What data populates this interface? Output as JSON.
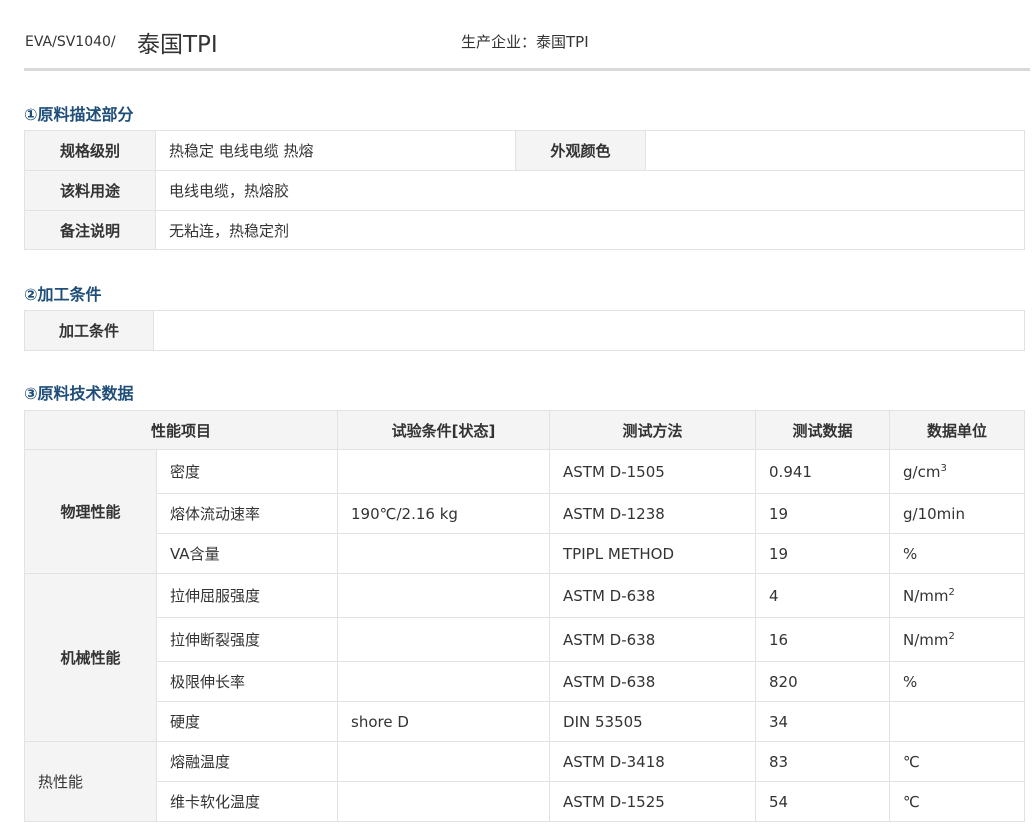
{
  "header": {
    "code": "EVA/SV1040/",
    "title": "泰国TPI",
    "producer": "生产企业：泰国TPI"
  },
  "section1": {
    "title": "①原料描述部分",
    "rows": [
      {
        "label": "规格级别",
        "value": "热稳定 电线电缆 热熔",
        "label2": "外观颜色",
        "value2": ""
      },
      {
        "label": "该料用途",
        "value": "电线电缆，热熔胶"
      },
      {
        "label": "备注说明",
        "value": "无粘连，热稳定剂"
      }
    ]
  },
  "section2": {
    "title": "②加工条件",
    "rows": [
      {
        "label": "加工条件",
        "value": ""
      }
    ]
  },
  "section3": {
    "title": "③原料技术数据",
    "headers": [
      "性能项目",
      "试验条件[状态]",
      "测试方法",
      "测试数据",
      "数据单位"
    ],
    "groups": [
      {
        "name": "物理性能",
        "rows": [
          {
            "item": "密度",
            "cond": "",
            "method": "ASTM D-1505",
            "data": "0.941",
            "unit": "g/cm",
            "sup": "3"
          },
          {
            "item": "熔体流动速率",
            "cond": "190℃/2.16 kg",
            "method": "ASTM D-1238",
            "data": "19",
            "unit": "g/10min",
            "sup": ""
          },
          {
            "item": "VA含量",
            "cond": "",
            "method": "TPIPL METHOD",
            "data": "19",
            "unit": "%",
            "sup": ""
          }
        ]
      },
      {
        "name": "机械性能",
        "rows": [
          {
            "item": "拉伸屈服强度",
            "cond": "",
            "method": "ASTM D-638",
            "data": "4",
            "unit": "N/mm",
            "sup": "2"
          },
          {
            "item": "拉伸断裂强度",
            "cond": "",
            "method": "ASTM D-638",
            "data": "16",
            "unit": "N/mm",
            "sup": "2"
          },
          {
            "item": "极限伸长率",
            "cond": "",
            "method": "ASTM D-638",
            "data": "820",
            "unit": "%",
            "sup": ""
          },
          {
            "item": "硬度",
            "cond": "shore D",
            "method": "DIN 53505",
            "data": "34",
            "unit": "",
            "sup": ""
          }
        ]
      },
      {
        "name": "热性能",
        "rows": [
          {
            "item": "熔融温度",
            "cond": "",
            "method": "ASTM D-3418",
            "data": "83",
            "unit": "℃",
            "sup": ""
          },
          {
            "item": "维卡软化温度",
            "cond": "",
            "method": "ASTM D-1525",
            "data": "54",
            "unit": "℃",
            "sup": ""
          }
        ]
      }
    ]
  }
}
